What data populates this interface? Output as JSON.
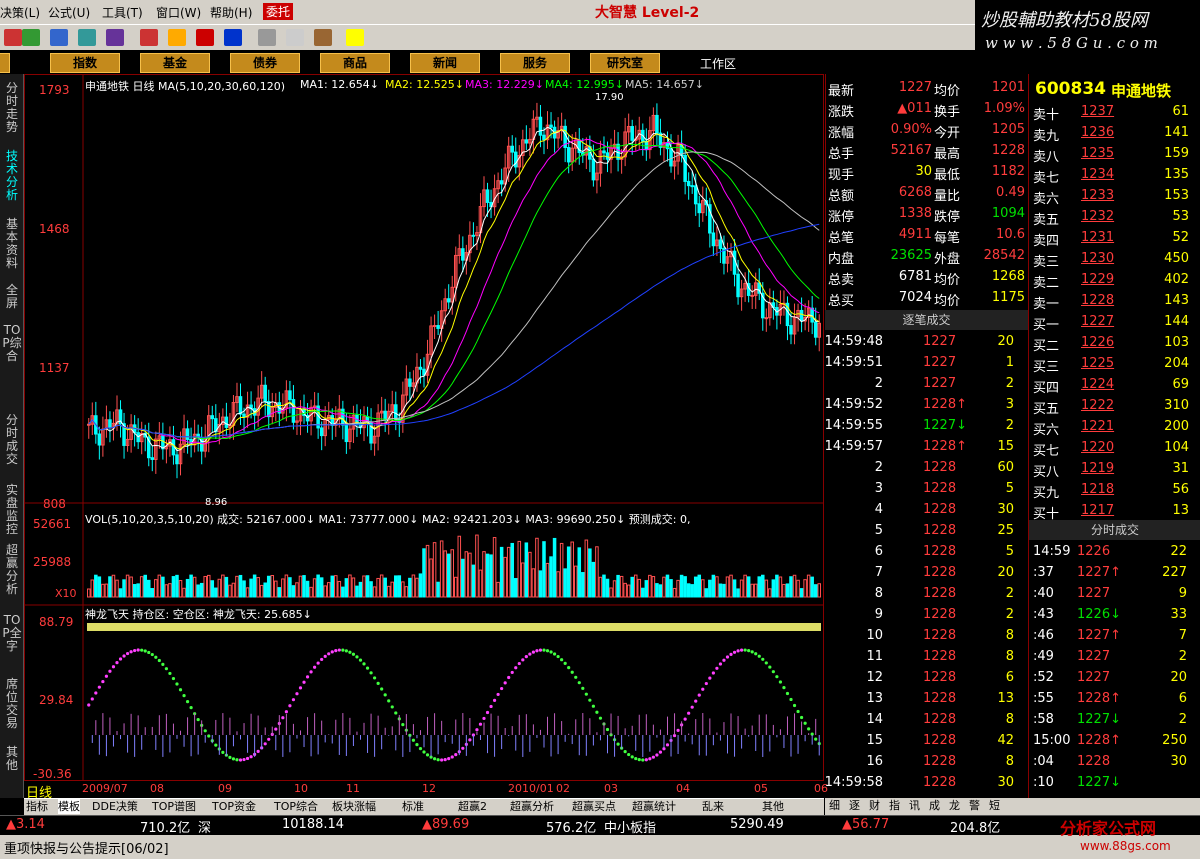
{
  "menu": {
    "items": [
      "决策(L)",
      "公式(U)",
      "工具(T)",
      "窗口(W)",
      "帮助(H)"
    ],
    "wt": "委托"
  },
  "banner": {
    "title": "大智慧 Level-2"
  },
  "watermark": {
    "line1": "炒股輔助教材58股网",
    "line2": "w w w . 5 8 G u . c o m"
  },
  "nav": {
    "items": [
      "股",
      "指数",
      "基金",
      "债券",
      "商品",
      "新闻",
      "服务",
      "研究室"
    ],
    "work": "工作区"
  },
  "left_tabs": [
    "分时走势",
    "技术分析",
    "基本资料",
    "全屏",
    "TOP综合",
    "分时成交",
    "实盘监控",
    "超赢分析",
    "TOP全字",
    "席位交易",
    "其他"
  ],
  "main_chart": {
    "header": "申通地铁 日线 MA(5,10,20,30,60,120)",
    "ma": [
      {
        "label": "MA1: 12.654↓",
        "color": "#ffffff"
      },
      {
        "label": "MA2: 12.525↓",
        "color": "#ffff00"
      },
      {
        "label": "MA3: 12.229↓",
        "color": "#ff00ff"
      },
      {
        "label": "MA4: 12.995↓",
        "color": "#00ff00"
      },
      {
        "label": "MA5: 14.657↓",
        "color": "#c0c0c0"
      }
    ],
    "ymax_label": "1793",
    "high_marker": "17.90",
    "yticks": [
      "1793",
      "1468",
      "1137",
      "808"
    ],
    "low_marker": "8.96",
    "vol_header": "VOL(5,10,20,3,5,10,20) 成交: 52167.000↓ MA1: 73777.000↓ MA2: 92421.203↓ MA3: 99690.250↓ 预测成交: 0,",
    "vol_ticks": [
      "52661",
      "25988",
      "X10"
    ],
    "ind_header": "神龙飞天 持仓区: 空仓区: 神龙飞天: 25.685↓",
    "ind_ticks": [
      "88.79",
      "29.84",
      "-30.36"
    ]
  },
  "chart_data": {
    "type": "candlestick",
    "dates": [
      "2009/07",
      "08",
      "09",
      "10",
      "11",
      "12",
      "2010/01",
      "02",
      "03",
      "04",
      "05",
      "06"
    ],
    "close": [
      9.6,
      9.8,
      9.3,
      9.2,
      9.5,
      10.0,
      10.3,
      10.2,
      9.9,
      9.8,
      9.7,
      10.2,
      11.5,
      13.5,
      15.0,
      16.2,
      17.0,
      16.5,
      16.0,
      16.6,
      16.8,
      16.0,
      14.5,
      13.2,
      12.6,
      12.3
    ],
    "ylim": [
      8.08,
      17.93
    ]
  },
  "quote": {
    "rows": [
      [
        "最新",
        "1227",
        "均价",
        "1201"
      ],
      [
        "涨跌",
        "▲011",
        "换手",
        "1.09%"
      ],
      [
        "涨幅",
        "0.90%",
        "今开",
        "1205"
      ],
      [
        "总手",
        "52167",
        "最高",
        "1228"
      ],
      [
        "现手",
        "30",
        "最低",
        "1182"
      ],
      [
        "总额",
        "6268",
        "量比",
        "0.49"
      ],
      [
        "涨停",
        "1338",
        "跌停",
        "1094"
      ],
      [
        "总笔",
        "4911",
        "每笔",
        "10.6"
      ],
      [
        "内盘",
        "23625",
        "外盘",
        "28542"
      ],
      [
        "总卖",
        "6781",
        "均价",
        "1268"
      ],
      [
        "总买",
        "7024",
        "均价",
        "1175"
      ]
    ]
  },
  "trades": {
    "title": "逐笔成交",
    "rows": [
      [
        "14:59:48",
        "1227",
        "20"
      ],
      [
        "14:59:51",
        "1227",
        "1"
      ],
      [
        "2",
        "1227",
        "2"
      ],
      [
        "14:59:52",
        "1228↑",
        "3"
      ],
      [
        "14:59:55",
        "1227↓",
        "2"
      ],
      [
        "14:59:57",
        "1228↑",
        "15"
      ],
      [
        "2",
        "1228",
        "60"
      ],
      [
        "3",
        "1228",
        "5"
      ],
      [
        "4",
        "1228",
        "30"
      ],
      [
        "5",
        "1228",
        "25"
      ],
      [
        "6",
        "1228",
        "5"
      ],
      [
        "7",
        "1228",
        "20"
      ],
      [
        "8",
        "1228",
        "2"
      ],
      [
        "9",
        "1228",
        "2"
      ],
      [
        "10",
        "1228",
        "8"
      ],
      [
        "11",
        "1228",
        "8"
      ],
      [
        "12",
        "1228",
        "6"
      ],
      [
        "13",
        "1228",
        "13"
      ],
      [
        "14",
        "1228",
        "8"
      ],
      [
        "15",
        "1228",
        "42"
      ],
      [
        "16",
        "1228",
        "8"
      ],
      [
        "14:59:58",
        "1228",
        "30"
      ]
    ]
  },
  "orderbook": {
    "code": "600834",
    "name": "申通地铁",
    "asks": [
      [
        "卖十",
        "1237",
        "61"
      ],
      [
        "卖九",
        "1236",
        "141"
      ],
      [
        "卖八",
        "1235",
        "159"
      ],
      [
        "卖七",
        "1234",
        "135"
      ],
      [
        "卖六",
        "1233",
        "153"
      ],
      [
        "卖五",
        "1232",
        "53"
      ],
      [
        "卖四",
        "1231",
        "52"
      ],
      [
        "卖三",
        "1230",
        "450"
      ],
      [
        "卖二",
        "1229",
        "402"
      ],
      [
        "卖一",
        "1228",
        "143"
      ]
    ],
    "bids": [
      [
        "买一",
        "1227",
        "144"
      ],
      [
        "买二",
        "1226",
        "103"
      ],
      [
        "买三",
        "1225",
        "204"
      ],
      [
        "买四",
        "1224",
        "69"
      ],
      [
        "买五",
        "1222",
        "310"
      ],
      [
        "买六",
        "1221",
        "200"
      ],
      [
        "买七",
        "1220",
        "104"
      ],
      [
        "买八",
        "1219",
        "31"
      ],
      [
        "买九",
        "1218",
        "56"
      ],
      [
        "买十",
        "1217",
        "13"
      ]
    ]
  },
  "ticks": {
    "title": "分时成交",
    "rows": [
      [
        "14:59",
        "1226",
        "22"
      ],
      [
        ":37",
        "1227↑",
        "227"
      ],
      [
        ":40",
        "1227",
        "9"
      ],
      [
        ":43",
        "1226↓",
        "33"
      ],
      [
        ":46",
        "1227↑",
        "7"
      ],
      [
        ":49",
        "1227",
        "2"
      ],
      [
        ":52",
        "1227",
        "20"
      ],
      [
        ":55",
        "1228↑",
        "6"
      ],
      [
        ":58",
        "1227↓",
        "2"
      ],
      [
        "15:00",
        "1228↑",
        "250"
      ],
      [
        ":04",
        "1228",
        "30"
      ],
      [
        ":10",
        "1227↓",
        ""
      ]
    ]
  },
  "bottom_tabs": [
    "指标",
    "模板",
    "DDE决策",
    "TOP谱图",
    "TOP资金",
    "TOP综合",
    "板块涨幅",
    "标准",
    "超赢2",
    "超赢分析",
    "超赢买点",
    "超赢统计",
    "乱来",
    "其他"
  ],
  "date_bar": {
    "period": "日线",
    "dates": [
      "2009/07",
      "08",
      "09",
      "10",
      "11",
      "12",
      "2010/01",
      "02",
      "03",
      "04",
      "05",
      "06"
    ]
  },
  "right_tabs": [
    "细",
    "逐",
    "财",
    "指",
    "讯",
    "成",
    "龙",
    "警",
    "短"
  ],
  "status": {
    "a": "▲3.14",
    "b": "710.2亿",
    "c": "深",
    "d": "10188.14",
    "e": "▲89.69",
    "f": "576.2亿",
    "g": "中小板指",
    "h": "5290.49",
    "i": "▲56.77",
    "j": "204.8亿"
  },
  "status2": {
    "text": "重项快报与公告提示[06/02]",
    "logo": "分析家公式网",
    "logo_url": "www.88gs.com"
  }
}
